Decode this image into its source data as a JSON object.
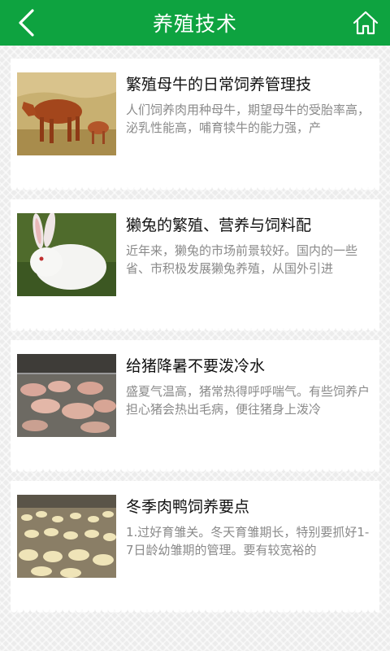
{
  "header": {
    "title": "养殖技术",
    "back_icon": "chevron-left-icon",
    "home_icon": "home-icon"
  },
  "colors": {
    "header_bg": "#0ea340",
    "title_text": "#111111",
    "desc_text": "#8a8a8a"
  },
  "articles": [
    {
      "title": "繁殖母牛的日常饲养管理技",
      "desc": "人们饲养肉用种母牛，期望母牛的受胎率高，泌乳性能高，哺育犊牛的能力强，产"
    },
    {
      "title": "獭兔的繁殖、营养与饲料配",
      "desc": "近年来，獭兔的市场前景较好。国内的一些省、市积极发展獭兔养殖，从国外引进"
    },
    {
      "title": "给猪降暑不要泼冷水",
      "desc": "盛夏气温高，猪常热得呼呼喘气。有些饲养户担心猪会热出毛病，便往猪身上泼冷"
    },
    {
      "title": "冬季肉鸭饲养要点",
      "desc": "1.过好育雏关。冬天育雏期长，特别要抓好1-7日龄幼雏期的管理。要有较宽裕的"
    }
  ]
}
